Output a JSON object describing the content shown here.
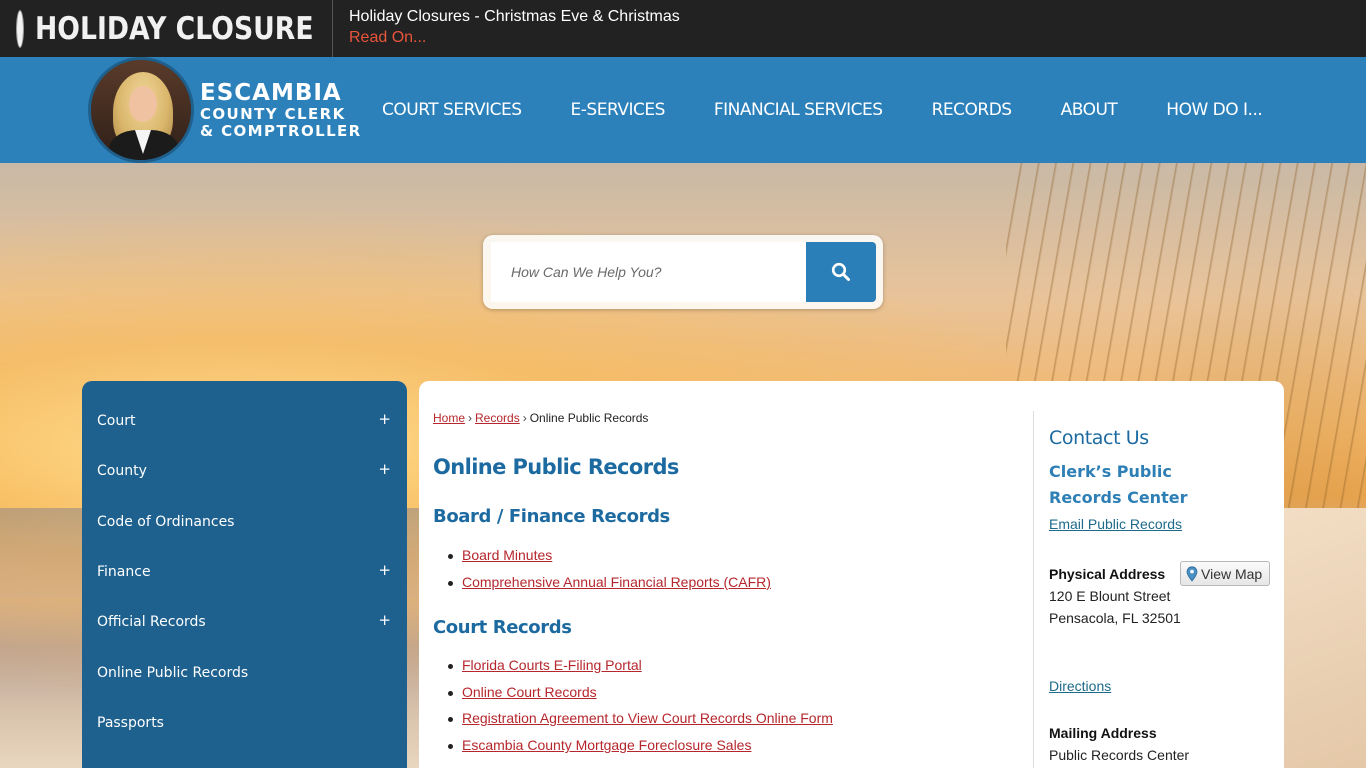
{
  "alert": {
    "title": "HOLIDAY CLOSURE",
    "message": "Holiday Closures - Christmas Eve & Christmas",
    "link": "Read On..."
  },
  "logo": {
    "line1": "ESCAMBIA",
    "line2": "COUNTY CLERK",
    "line3": "& COMPTROLLER"
  },
  "nav": {
    "items": [
      "COURT SERVICES",
      "E-SERVICES",
      "FINANCIAL SERVICES",
      "RECORDS",
      "ABOUT",
      "HOW DO I..."
    ]
  },
  "search": {
    "placeholder": "How Can We Help You?"
  },
  "sidebar": {
    "items": [
      {
        "label": "Court",
        "expandable": "+"
      },
      {
        "label": "County",
        "expandable": "+"
      },
      {
        "label": "Code of Ordinances",
        "expandable": ""
      },
      {
        "label": "Finance",
        "expandable": "+"
      },
      {
        "label": "Official Records",
        "expandable": "+"
      },
      {
        "label": "Online Public Records",
        "expandable": ""
      },
      {
        "label": "Passports",
        "expandable": ""
      }
    ]
  },
  "breadcrumb": {
    "home": "Home",
    "records": "Records",
    "current": "Online Public Records",
    "separator": "›"
  },
  "main": {
    "title": "Online Public Records",
    "sections": [
      {
        "heading": "Board / Finance Records",
        "links": [
          "Board Minutes",
          "Comprehensive Annual Financial Reports (CAFR)"
        ]
      },
      {
        "heading": "Court Records",
        "links": [
          "Florida Courts E-Filing Portal",
          "Online Court Records",
          "Registration Agreement to View Court Records Online Form",
          "Escambia County Mortgage Foreclosure Sales"
        ]
      }
    ]
  },
  "contact": {
    "heading": "Contact Us",
    "subheading": "Clerk’s Public Records Center",
    "email_link": "Email Public Records",
    "physical_label": "Physical Address",
    "view_map": "View Map",
    "address_line1": "120 E Blount Street",
    "address_line2": "Pensacola, FL 32501",
    "directions": "Directions",
    "mailing_label": "Mailing Address",
    "mailing_line1": "Public Records Center"
  },
  "colors": {
    "alert_bg": "#222222",
    "header_blue": "#2c81bb",
    "sidebar_blue": "#1e618f",
    "title_blue": "#1d6aa0",
    "link_red": "#b5272d"
  }
}
